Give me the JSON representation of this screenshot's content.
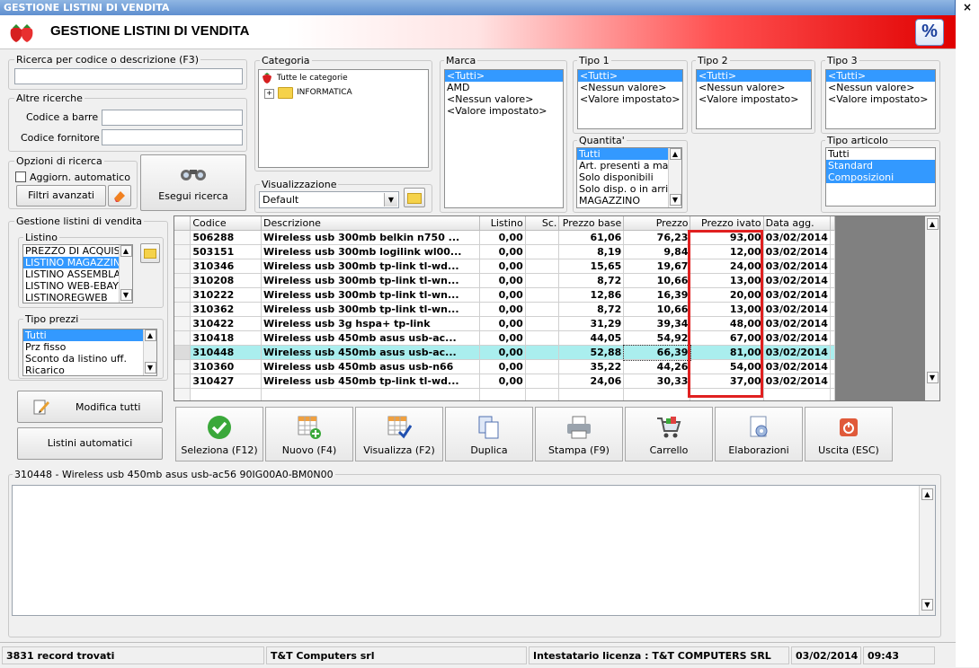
{
  "window": {
    "title": "GESTIONE LISTINI DI VENDITA",
    "close_label": "×"
  },
  "header": {
    "title": "GESTIONE LISTINI DI VENDITA",
    "percent_icon_label": "%"
  },
  "search": {
    "group_label": "Ricerca per codice o descrizione (F3)",
    "value": ""
  },
  "other_searches": {
    "group_label": "Altre ricerche",
    "barcode_label": "Codice a barre :",
    "supplier_code_label": "Codice fornitore :"
  },
  "search_options": {
    "group_label": "Opzioni di ricerca",
    "auto_update_label": "Aggiorn. automatico",
    "auto_update_checked": false,
    "advanced_filters_label": "Filtri avanzati",
    "run_search_label": "Esegui ricerca"
  },
  "category": {
    "group_label": "Categoria",
    "root_label": "Tutte le categorie",
    "children": [
      "INFORMATICA"
    ]
  },
  "view": {
    "group_label": "Visualizzazione",
    "selected": "Default"
  },
  "brand": {
    "group_label": "Marca",
    "items": [
      "<Tutti>",
      "AMD",
      "<Nessun valore>",
      "<Valore impostato>"
    ],
    "selected_index": 0
  },
  "tipo1": {
    "group_label": "Tipo 1",
    "items": [
      "<Tutti>",
      "<Nessun valore>",
      "<Valore impostato>"
    ],
    "selected_index": 0
  },
  "tipo2": {
    "group_label": "Tipo 2",
    "items": [
      "<Tutti>",
      "<Nessun valore>",
      "<Valore impostato>"
    ],
    "selected_index": 0
  },
  "tipo3": {
    "group_label": "Tipo 3",
    "items": [
      "<Tutti>",
      "<Nessun valore>",
      "<Valore impostato>"
    ],
    "selected_index": 0
  },
  "quantity": {
    "group_label": "Quantita'",
    "items": [
      "Tutti",
      "Art. presenti a magazzino",
      "Solo disponibili",
      "Solo disp. o in arrivo",
      "MAGAZZINO"
    ],
    "selected_index": 0
  },
  "article_type": {
    "group_label": "Tipo articolo",
    "items": [
      "Tutti",
      "Standard",
      "Composizioni"
    ],
    "selected_indexes": [
      1,
      2
    ]
  },
  "price_lists": {
    "group_label": "Gestione listini di vendita",
    "listino_label": "Listino",
    "items": [
      "PREZZO DI ACQUISTO",
      "LISTINO MAGAZZINO",
      "LISTINO ASSEMBLATI",
      "LISTINO WEB-EBAY",
      "LISTINOREGWEB"
    ],
    "selected_index": 1
  },
  "price_types": {
    "group_label": "Tipo prezzi",
    "items": [
      "Tutti",
      "Prz fisso",
      "Sconto da listino uff.",
      "Ricarico"
    ],
    "selected_index": 0
  },
  "actions_left": {
    "modify_all_label": "Modifica tutti",
    "auto_lists_label": "Listini automatici"
  },
  "grid": {
    "columns": [
      "Codice",
      "Descrizione",
      "Listino",
      "Sc.",
      "Prezzo base",
      "Prezzo",
      "Prezzo ivato",
      "Data agg."
    ],
    "rows": [
      [
        "506288",
        "Wireless usb 300mb belkin n750 ...",
        "0,00",
        "",
        "61,06",
        "76,23",
        "93,00",
        "03/02/2014"
      ],
      [
        "503151",
        "Wireless usb 300mb logilink wl00...",
        "0,00",
        "",
        "8,19",
        "9,84",
        "12,00",
        "03/02/2014"
      ],
      [
        "310346",
        "Wireless usb 300mb tp-link tl-wd...",
        "0,00",
        "",
        "15,65",
        "19,67",
        "24,00",
        "03/02/2014"
      ],
      [
        "310208",
        "Wireless usb 300mb tp-link tl-wn...",
        "0,00",
        "",
        "8,72",
        "10,66",
        "13,00",
        "03/02/2014"
      ],
      [
        "310222",
        "Wireless usb 300mb tp-link tl-wn...",
        "0,00",
        "",
        "12,86",
        "16,39",
        "20,00",
        "03/02/2014"
      ],
      [
        "310362",
        "Wireless usb 300mb tp-link tl-wn...",
        "0,00",
        "",
        "8,72",
        "10,66",
        "13,00",
        "03/02/2014"
      ],
      [
        "310422",
        "Wireless usb 3g hspa+ tp-link",
        "0,00",
        "",
        "31,29",
        "39,34",
        "48,00",
        "03/02/2014"
      ],
      [
        "310418",
        "Wireless usb 450mb asus usb-ac...",
        "0,00",
        "",
        "44,05",
        "54,92",
        "67,00",
        "03/02/2014"
      ],
      [
        "310448",
        "Wireless usb 450mb asus usb-ac...",
        "0,00",
        "",
        "52,88",
        "66,39",
        "81,00",
        "03/02/2014"
      ],
      [
        "310360",
        "Wireless usb 450mb asus usb-n66",
        "0,00",
        "",
        "35,22",
        "44,26",
        "54,00",
        "03/02/2014"
      ],
      [
        "310427",
        "Wireless usb 450mb tp-link tl-wd...",
        "0,00",
        "",
        "24,06",
        "30,33",
        "37,00",
        "03/02/2014"
      ]
    ],
    "selected_row": 8,
    "highlight_color": "#e02020",
    "selected_row_color": "#aaeeee"
  },
  "toolbar": {
    "buttons": [
      "Seleziona (F12)",
      "Nuovo (F4)",
      "Visualizza (F2)",
      "Duplica",
      "Stampa (F9)",
      "Carrello",
      "Elaborazioni",
      "Uscita (ESC)"
    ]
  },
  "detail": {
    "caption": "310448 - Wireless usb 450mb asus usb-ac56 90IG00A0-BM0N00",
    "text": ""
  },
  "status": {
    "records": "3831 record trovati",
    "company": "T&T Computers srl",
    "license": "Intestatario licenza : T&T COMPUTERS SRL",
    "date": "03/02/2014",
    "time": "09:43"
  }
}
